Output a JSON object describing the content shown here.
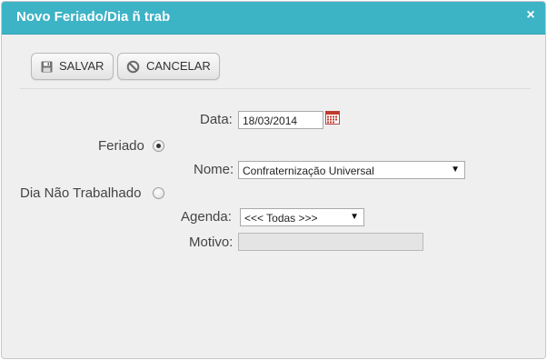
{
  "dialog": {
    "title": "Novo Feriado/Dia ñ trab",
    "close_glyph": "×"
  },
  "toolbar": {
    "save_label": "SALVAR",
    "save_icon": "floppy-disk-icon",
    "cancel_label": "CANCELAR",
    "cancel_icon": "cancel-circle-icon"
  },
  "form": {
    "data_label": "Data:",
    "data_value": "18/03/2014",
    "calendar_icon": "calendar-icon",
    "feriado_label": "Feriado",
    "feriado_selected": true,
    "nome_label": "Nome:",
    "nome_value": "Confraternização Universal",
    "dia_nao_trabalhado_label": "Dia Não Trabalhado",
    "dia_nao_trabalhado_selected": false,
    "agenda_label": "Agenda:",
    "agenda_value": "<<< Todas >>>",
    "motivo_label": "Motivo:",
    "motivo_value": ""
  },
  "colors": {
    "titlebar": "#3db3c6",
    "dialog_bg": "#efefef",
    "calendar_accent": "#c0392b"
  }
}
